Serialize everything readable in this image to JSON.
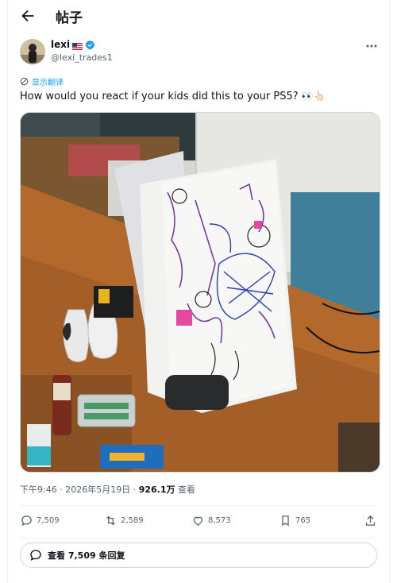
{
  "header": {
    "title": "帖子"
  },
  "author": {
    "name": "lexi",
    "handle": "@lexi_trades1"
  },
  "translate_label": "显示翻译",
  "tweet": {
    "text": "How would you react if your kids did this to your PS5?",
    "emojis": "👀👆🏻"
  },
  "media": {
    "alt": "Child's crayon drawing on PS5 console"
  },
  "meta": {
    "time": "下午9:46",
    "dot": "·",
    "date": "2026年5月19日",
    "views": "926.1万",
    "views_label": "查看"
  },
  "actions": {
    "replies": "7,509",
    "reposts": "2,589",
    "likes": "8,573",
    "bookmarks": "765"
  },
  "view_replies": "查看 7,509 条回复",
  "colors": {
    "accent": "#1d9bf0",
    "text": "#0f1419",
    "muted": "#536471",
    "border": "#cfd9de"
  }
}
